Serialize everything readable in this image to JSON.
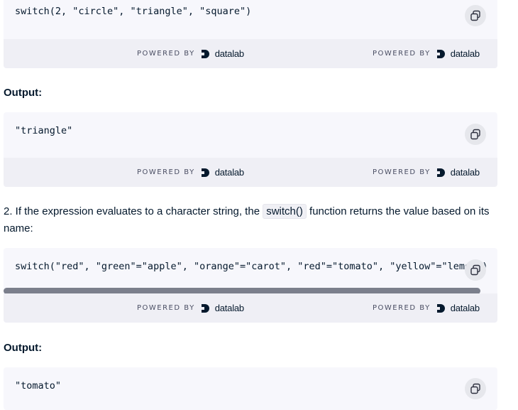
{
  "blocks": [
    {
      "code": "switch(2, \"circle\", \"triangle\", \"square\")"
    },
    {
      "code": "\"triangle\""
    },
    {
      "code": "switch(\"red\", \"green\"=\"apple\", \"orange\"=\"carot\", \"red\"=\"tomato\", \"yellow\"=\"lemon\")"
    },
    {
      "code": "\"tomato\""
    }
  ],
  "powered": {
    "label": "POWERED BY",
    "brand": "datalab"
  },
  "labels": {
    "output1": "Output:",
    "output2": "Output:"
  },
  "paragraph": {
    "before": "2. If the expression evaluates to a character string, the ",
    "code": "switch()",
    "after": " function returns the value based on its name:"
  },
  "icons": {
    "copy": "copy-icon",
    "logo": "datalab-logo-icon"
  }
}
